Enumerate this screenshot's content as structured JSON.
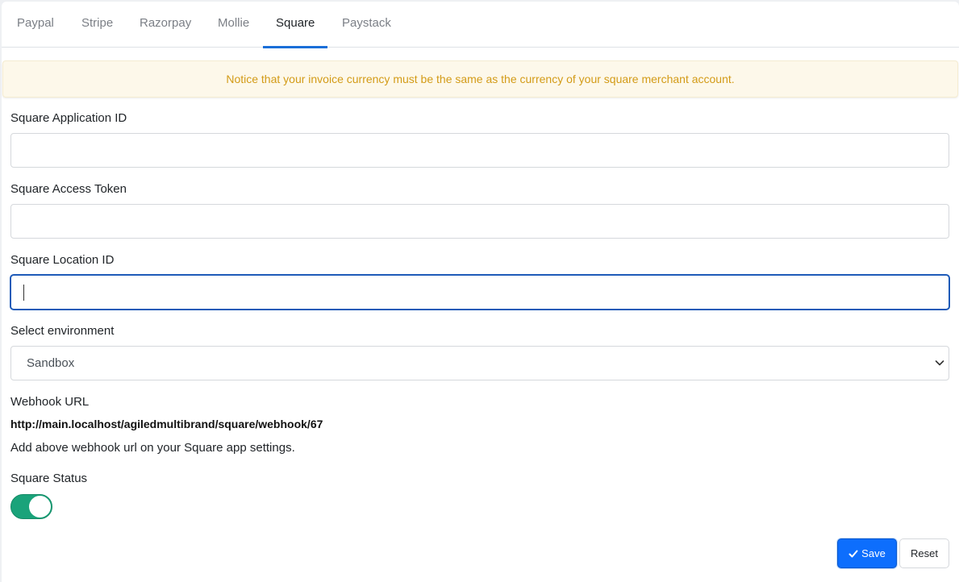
{
  "tabs": [
    {
      "label": "Paypal"
    },
    {
      "label": "Stripe"
    },
    {
      "label": "Razorpay"
    },
    {
      "label": "Mollie"
    },
    {
      "label": "Square",
      "active": true
    },
    {
      "label": "Paystack"
    }
  ],
  "notice": {
    "text": "Notice that your invoice currency must be the same as the currency of your square merchant account.",
    "color": "#d39b17",
    "background": "#fdf8ea"
  },
  "form": {
    "application_id": {
      "label": "Square Application ID",
      "value": ""
    },
    "access_token": {
      "label": "Square Access Token",
      "value": ""
    },
    "location_id": {
      "label": "Square Location ID",
      "value": ""
    },
    "environment": {
      "label": "Select environment",
      "selected": "Sandbox"
    },
    "webhook": {
      "label": "Webhook URL",
      "url": "http://main.localhost/agiledmultibrand/square/webhook/67",
      "helper": "Add above webhook url on your Square app settings."
    },
    "status": {
      "label": "Square Status",
      "enabled": true,
      "color": "#1aa37a"
    }
  },
  "actions": {
    "save_label": "Save",
    "reset_label": "Reset",
    "primary_color": "#0d6efd",
    "save_icon": "check-icon"
  },
  "accent_color": "#1a6fd8"
}
